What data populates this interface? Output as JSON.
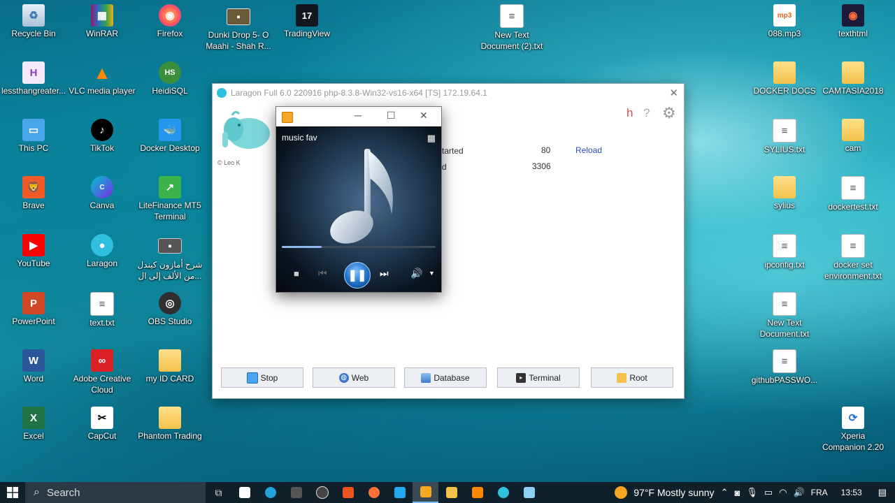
{
  "desktop_icons": [
    {
      "label": "Recycle Bin",
      "icon": "recycle-bin-icon"
    },
    {
      "label": "WinRAR",
      "icon": "winrar-icon"
    },
    {
      "label": "Firefox",
      "icon": "firefox-icon"
    },
    {
      "label": "Dunki Drop 5- O Maahi - Shah R...",
      "icon": "video-file-icon"
    },
    {
      "label": "TradingView",
      "icon": "tradingview-icon"
    },
    {
      "label": "New Text Document (2).txt",
      "icon": "text-file-icon"
    },
    {
      "label": "088.mp3",
      "icon": "mp3-file-icon"
    },
    {
      "label": "texthtml",
      "icon": "firefox-file-icon"
    },
    {
      "label": "lessthangreater...",
      "icon": "h-app-icon"
    },
    {
      "label": "VLC media player",
      "icon": "vlc-icon"
    },
    {
      "label": "HeidiSQL",
      "icon": "heidisql-icon"
    },
    {
      "label": "DOCKER DOCS",
      "icon": "folder-icon"
    },
    {
      "label": "CAMTASIA2018",
      "icon": "folder-icon"
    },
    {
      "label": "This PC",
      "icon": "this-pc-icon"
    },
    {
      "label": "TikTok",
      "icon": "tiktok-icon"
    },
    {
      "label": "Docker Desktop",
      "icon": "docker-icon"
    },
    {
      "label": "SYLIUS.txt",
      "icon": "text-file-icon"
    },
    {
      "label": "cam",
      "icon": "folder-icon"
    },
    {
      "label": "Brave",
      "icon": "brave-icon"
    },
    {
      "label": "Canva",
      "icon": "canva-icon"
    },
    {
      "label": "LiteFinance MT5 Terminal",
      "icon": "litefinance-icon"
    },
    {
      "label": "sylius",
      "icon": "folder-icon"
    },
    {
      "label": "dockertest.txt",
      "icon": "text-file-icon"
    },
    {
      "label": "YouTube",
      "icon": "youtube-icon"
    },
    {
      "label": "Laragon",
      "icon": "laragon-icon"
    },
    {
      "label": "شرح أمازون كيندل من الألف إلى ال...",
      "icon": "video-file-icon"
    },
    {
      "label": "ipconfig.txt",
      "icon": "text-file-icon"
    },
    {
      "label": "docker set environment.txt",
      "icon": "text-file-icon"
    },
    {
      "label": "PowerPoint",
      "icon": "powerpoint-icon"
    },
    {
      "label": "text.txt",
      "icon": "text-file-icon"
    },
    {
      "label": "OBS Studio",
      "icon": "obs-icon"
    },
    {
      "label": "New Text Document.txt",
      "icon": "text-file-icon"
    },
    {
      "label": "Word",
      "icon": "word-icon"
    },
    {
      "label": "Adobe Creative Cloud",
      "icon": "adobe-cc-icon"
    },
    {
      "label": "my ID CARD",
      "icon": "folder-icon"
    },
    {
      "label": "githubPASSWO...",
      "icon": "text-file-icon"
    },
    {
      "label": "Excel",
      "icon": "excel-icon"
    },
    {
      "label": "CapCut",
      "icon": "capcut-icon"
    },
    {
      "label": "Phantom Trading",
      "icon": "folder-icon"
    },
    {
      "label": "Xperia Companion 2.20",
      "icon": "xperia-icon"
    }
  ],
  "laragon": {
    "title": "Laragon Full 6.0 220916 php-8.3.8-Win32-vs16-x64 [TS]  172.19.64.1",
    "copyright": "© Leo K",
    "help_h": "h",
    "help_q": "?",
    "rows": [
      {
        "status": "tarted",
        "port": "80",
        "action": "Reload"
      },
      {
        "status": "d",
        "port": "3306",
        "action": ""
      }
    ],
    "buttons": [
      "Stop",
      "Web",
      "Database",
      "Terminal",
      "Root"
    ]
  },
  "media_player": {
    "title": "music fav",
    "progress_fraction": 0.26
  },
  "taskbar": {
    "search_placeholder": "Search",
    "weather": "97°F  Mostly sunny",
    "language": "FRA",
    "time": "13:53"
  },
  "colors": {
    "accent": "#1f6fc8",
    "taskbar": "#10202a",
    "laragon_link": "#2c4fbf"
  }
}
